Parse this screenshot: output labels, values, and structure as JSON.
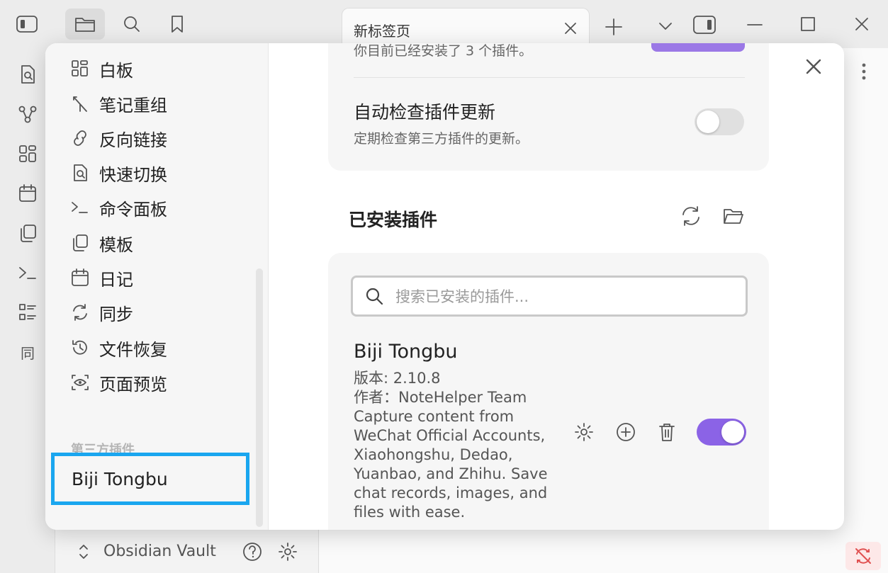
{
  "tab": {
    "title": "新标签页"
  },
  "vault": {
    "name": "Obsidian Vault"
  },
  "left_rail": {
    "sync_label": "同"
  },
  "settings": {
    "nav_items": [
      {
        "label": "白板",
        "icon": "canvas-icon"
      },
      {
        "label": "笔记重组",
        "icon": "merge-icon"
      },
      {
        "label": "反向链接",
        "icon": "backlink-icon"
      },
      {
        "label": "快速切换",
        "icon": "quick-switch-icon"
      },
      {
        "label": "命令面板",
        "icon": "terminal-icon"
      },
      {
        "label": "模板",
        "icon": "template-icon"
      },
      {
        "label": "日记",
        "icon": "calendar-icon"
      },
      {
        "label": "同步",
        "icon": "sync-icon"
      },
      {
        "label": "文件恢复",
        "icon": "history-icon"
      },
      {
        "label": "页面预览",
        "icon": "preview-icon"
      }
    ],
    "third_party_heading": "第三方插件",
    "third_party_items": [
      {
        "label": "Biji Tongbu"
      }
    ]
  },
  "community": {
    "installed_count_text": "你目前已经安装了 3 个插件。",
    "auto_check": {
      "name": "自动检查插件更新",
      "desc": "定期检查第三方插件的更新。",
      "enabled": false
    },
    "installed_title": "已安装插件",
    "search_placeholder": "搜索已安装的插件...",
    "plugin": {
      "name": "Biji Tongbu",
      "version": "版本: 2.10.8",
      "author": "作者：NoteHelper Team",
      "description_lines": [
        "Capture content from",
        "WeChat Official Accounts,",
        "Xiaohongshu, Dedao,",
        "Yuanbao, and Zhihu. Save",
        "chat records, images, and",
        "files with ease."
      ],
      "enabled": true
    }
  },
  "colors": {
    "accent": "#8b63e6",
    "highlight": "#1aa6ef"
  }
}
